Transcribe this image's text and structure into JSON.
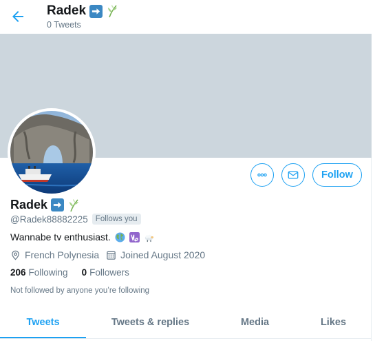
{
  "header": {
    "name": "Radek",
    "tweet_count": "0 Tweets"
  },
  "profile": {
    "name": "Radek",
    "handle": "@Radek88882225",
    "follows_you": "Follows you",
    "bio": "Wannabe tv enthusiast.",
    "location": "French Polynesia",
    "joined": "Joined August 2020",
    "following_count": "206",
    "following_label": "Following",
    "followers_count": "0",
    "followers_label": "Followers",
    "not_followed_text": "Not followed by anyone you’re following"
  },
  "actions": {
    "follow_label": "Follow"
  },
  "tabs": [
    {
      "label": "Tweets",
      "active": true
    },
    {
      "label": "Tweets & replies",
      "active": false
    },
    {
      "label": "Media",
      "active": false
    },
    {
      "label": "Likes",
      "active": false
    }
  ],
  "icons": {
    "back": "arrow-left-icon",
    "more": "more-dots-icon",
    "message": "envelope-icon",
    "location": "location-pin-icon",
    "joined": "calendar-icon",
    "name_emoji": [
      "right-arrow-emoji",
      "herb-emoji"
    ],
    "bio_emoji": [
      "globe-emoji",
      "capricorn-emoji",
      "sheep-emoji"
    ]
  },
  "colors": {
    "accent": "#1da1f2",
    "banner": "#ccd6dd",
    "muted_text": "#657786",
    "text": "#14171a"
  }
}
